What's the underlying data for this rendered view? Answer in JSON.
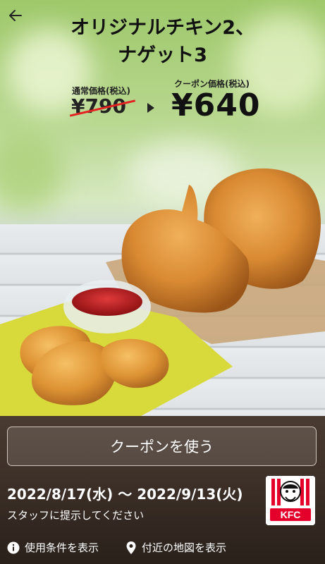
{
  "nav": {
    "back_icon": "arrow-left-icon"
  },
  "offer": {
    "title_line1": "オリジナルチキン2、",
    "title_line2": "ナゲット3",
    "regular_price_label": "通常価格(税込)",
    "regular_price": "¥790",
    "coupon_price_label": "クーポン価格(税込)",
    "coupon_price": "¥640"
  },
  "actions": {
    "use_coupon": "クーポンを使う"
  },
  "validity": {
    "period": "2022/8/17(水) 〜 2022/9/13(火)",
    "notice": "スタッフに提示してください"
  },
  "links": {
    "terms": "使用条件を表示",
    "map": "付近の地図を表示"
  },
  "brand": {
    "logo_text": "KFC",
    "accent": "#e4002b"
  }
}
